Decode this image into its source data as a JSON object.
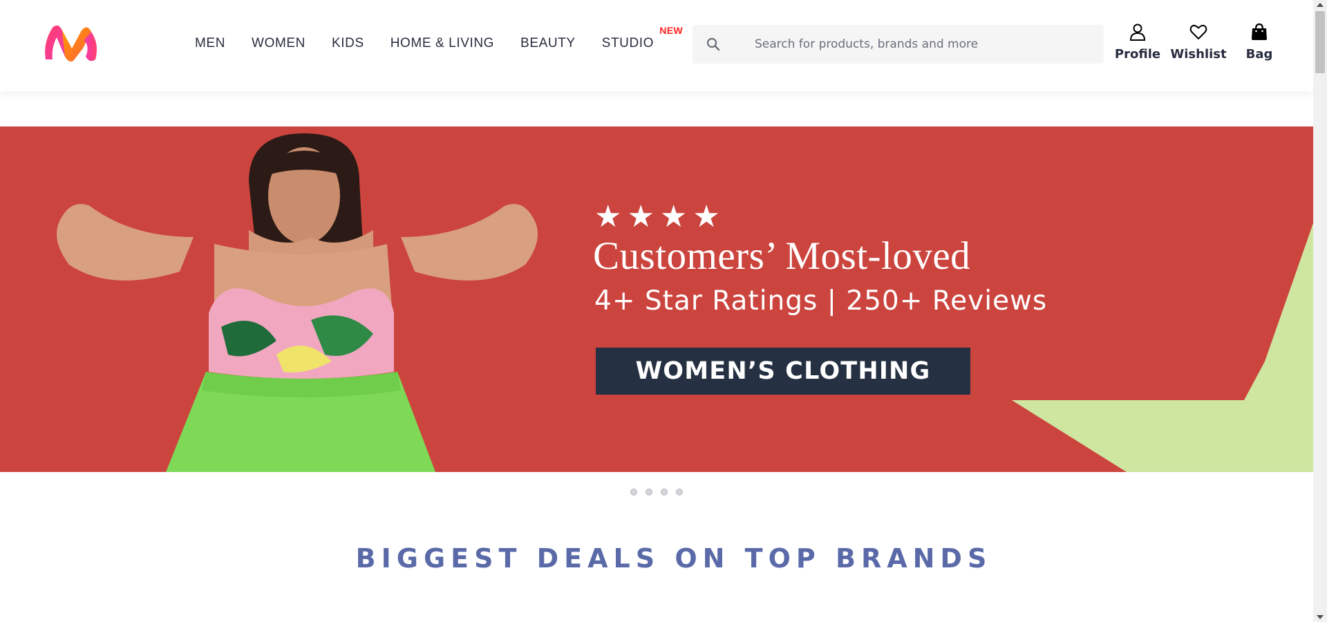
{
  "header": {
    "nav": [
      {
        "label": "MEN"
      },
      {
        "label": "WOMEN"
      },
      {
        "label": "KIDS"
      },
      {
        "label": "HOME & LIVING"
      },
      {
        "label": "BEAUTY"
      },
      {
        "label": "STUDIO",
        "badge": "NEW"
      }
    ],
    "search": {
      "placeholder": "Search for products, brands and more",
      "value": ""
    },
    "actions": [
      {
        "label": "Profile",
        "icon": "profile-icon"
      },
      {
        "label": "Wishlist",
        "icon": "heart-icon"
      },
      {
        "label": "Bag",
        "icon": "bag-icon"
      }
    ]
  },
  "banner": {
    "stars": "★★★★",
    "title": "Customers’ Most-loved",
    "subtitle": "4+ Star Ratings | 250+ Reviews",
    "cta_label": "WOMEN’S CLOTHING",
    "colors": {
      "background": "#cc443e",
      "accent": "#cfe6a0",
      "cta": "#253142"
    }
  },
  "carousel": {
    "total": 4,
    "current": 1
  },
  "section": {
    "title": "BIGGEST DEALS ON TOP BRANDS"
  },
  "colors": {
    "brand_badge": "#ff1f1f",
    "section_title": "#5a6aa8"
  }
}
